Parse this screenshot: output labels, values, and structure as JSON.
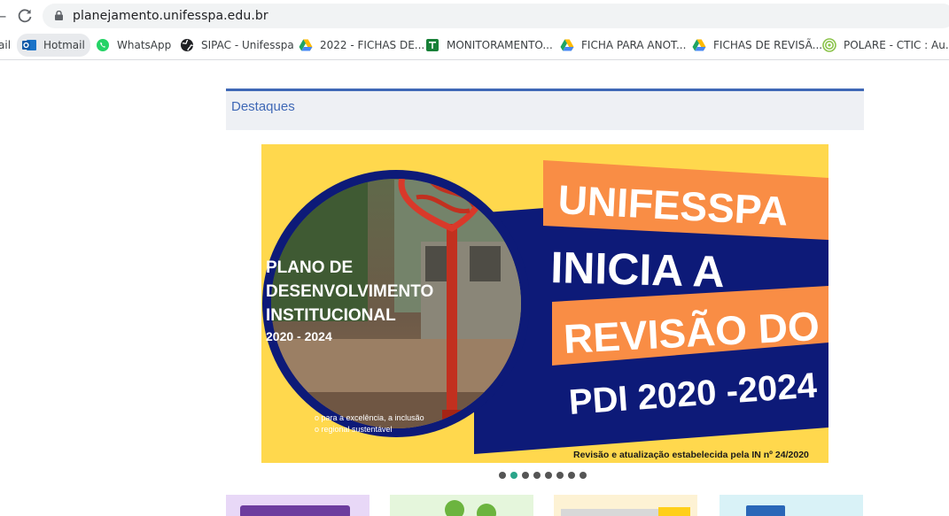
{
  "browser": {
    "url": "planejamento.unifesspa.edu.br",
    "bookmarks": [
      {
        "label": "ail",
        "icon": "mail-icon"
      },
      {
        "label": "Hotmail",
        "icon": "outlook-icon"
      },
      {
        "label": "WhatsApp",
        "icon": "whatsapp-icon"
      },
      {
        "label": "SIPAC - Unifesspa",
        "icon": "globe-icon"
      },
      {
        "label": "2022 - FICHAS DE...",
        "icon": "google-drive-icon"
      },
      {
        "label": "MONITORAMENTO...",
        "icon": "google-sheets-icon"
      },
      {
        "label": "FICHA PARA ANOT...",
        "icon": "google-drive-icon"
      },
      {
        "label": "FICHAS DE REVISÃ...",
        "icon": "google-drive-icon"
      },
      {
        "label": "POLARE - CTIC : Au...",
        "icon": "polare-icon"
      }
    ]
  },
  "section": {
    "title": "Destaques"
  },
  "banner": {
    "left_title_lines": [
      "PLANO DE",
      "DESENVOLVIMENTO",
      "INSTITUCIONAL"
    ],
    "left_years": "2020 - 2024",
    "left_caption_lines": [
      "o para a excelência, a inclusão",
      "o regional sustentável"
    ],
    "headline": [
      "UNIFESSPA",
      "INICIA A",
      "REVISÃO DO",
      "PDI 2020 -2024"
    ],
    "footer": "Revisão e atualização estabelecida pela IN nº 24/2020",
    "colors": {
      "yellow": "#ffd84d",
      "orange": "#f98d45",
      "navy": "#0d1a78"
    }
  },
  "carousel": {
    "count": 8,
    "active": 1
  },
  "cards": [
    "card-1",
    "card-2",
    "card-3",
    "card-4"
  ]
}
